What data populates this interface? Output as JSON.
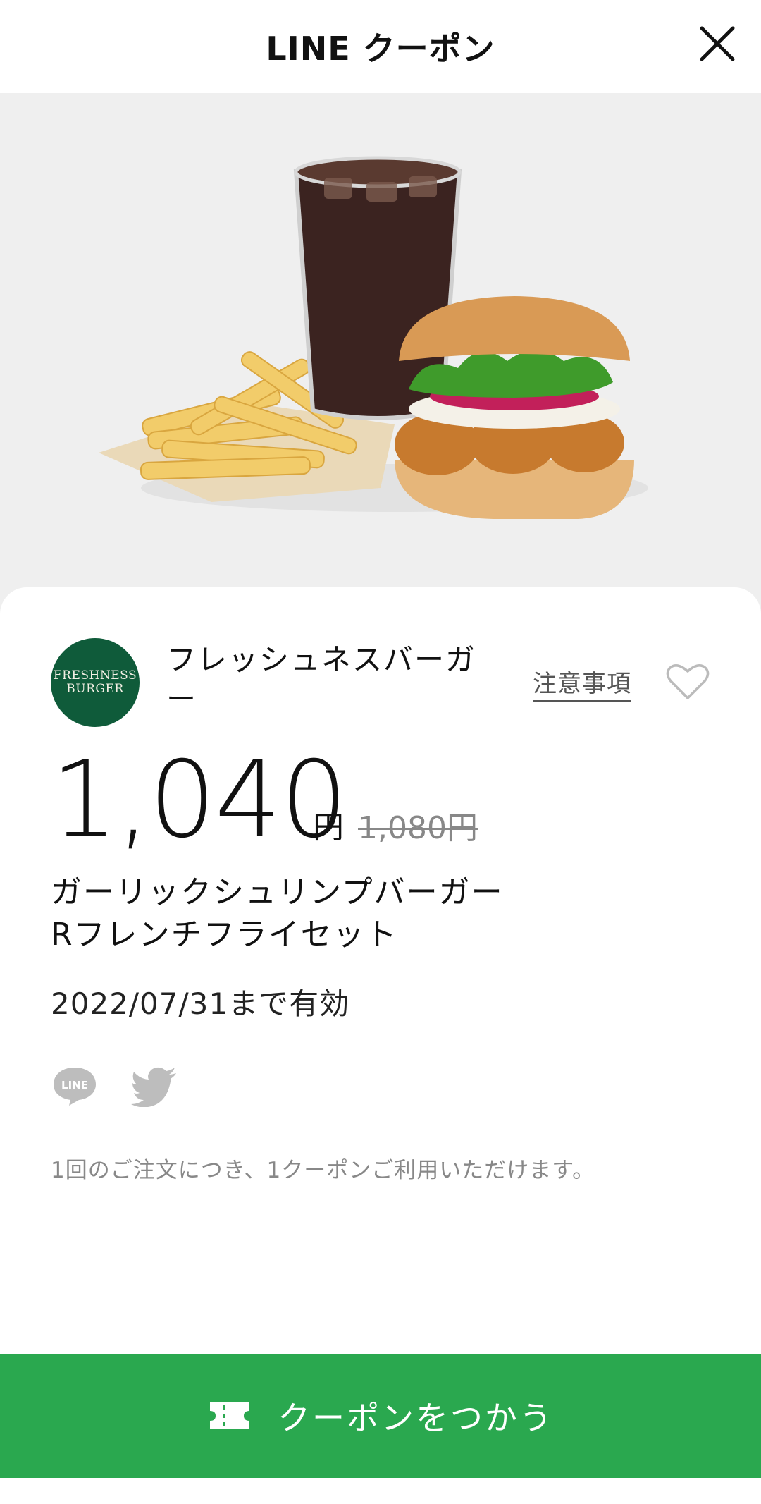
{
  "header": {
    "title": "LINE クーポン",
    "close_icon": "close-icon"
  },
  "hero": {
    "image_alt": "Cola, French fries and shrimp burger set"
  },
  "brand": {
    "logo_line1": "FRESHNESS",
    "logo_line2": "BURGER",
    "name": "フレッシュネスバーガー",
    "logo_color": "#0f5b3a"
  },
  "notes_link": "注意事項",
  "favorite_icon": "heart-icon",
  "price": {
    "value": "1,040",
    "currency": "円",
    "original": "1,080円"
  },
  "product": {
    "line1": "ガーリックシュリンプバーガー",
    "line2": "Rフレンチフライセット"
  },
  "valid_until": "2022/07/31まで有効",
  "share": {
    "line_icon": "line-icon",
    "twitter_icon": "twitter-icon",
    "line_text": "LINE"
  },
  "note": "1回のご注文につき、1クーポンご利用いただけます。",
  "cta": {
    "label": "クーポンをつかう",
    "icon": "ticket-icon",
    "color": "#2aa84f"
  }
}
